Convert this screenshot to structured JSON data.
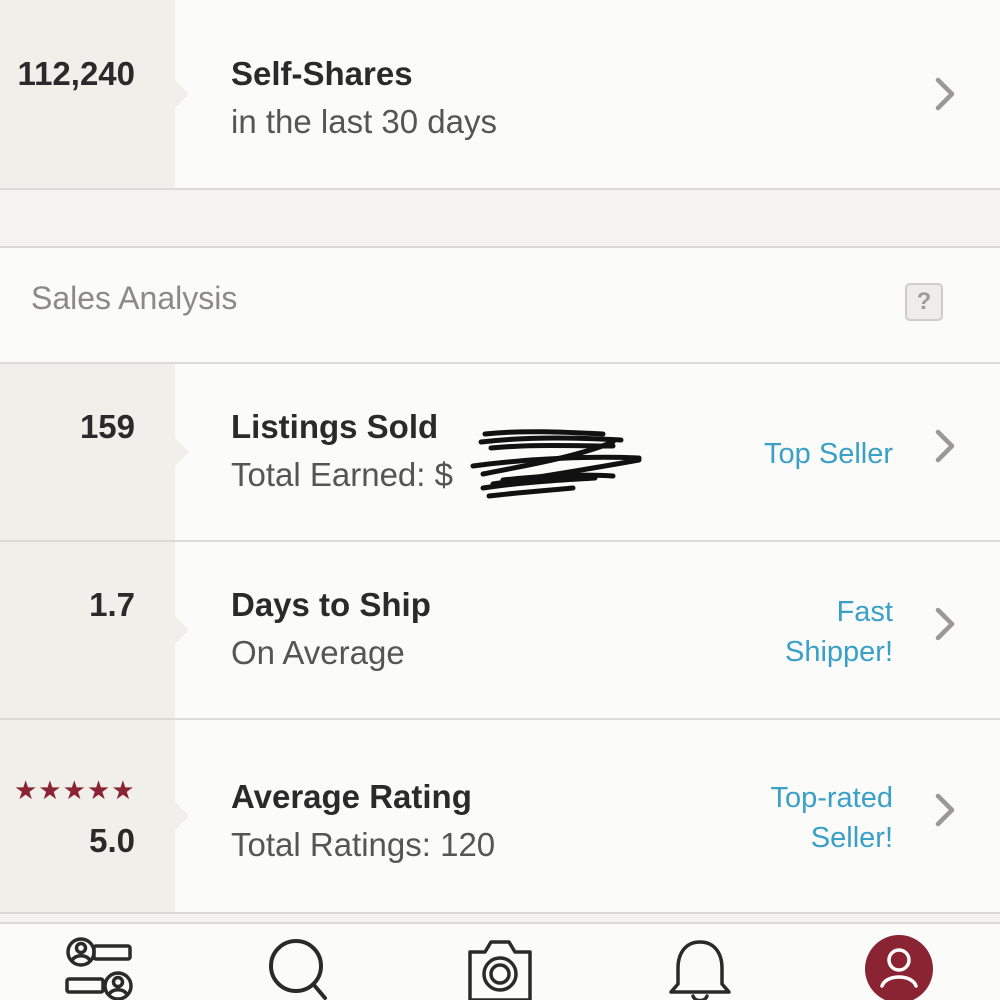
{
  "self_shares": {
    "count": "112,240",
    "title": "Self-Shares",
    "subtitle": "in the last 30 days"
  },
  "sales_analysis": {
    "title": "Sales Analysis",
    "help_label": "?",
    "rows": [
      {
        "stat": "159",
        "title": "Listings Sold",
        "subtitle": "Total Earned: $",
        "badge": "Top Seller"
      },
      {
        "stat": "1.7",
        "title": "Days to Ship",
        "subtitle": "On Average",
        "badge": "Fast Shipper!"
      },
      {
        "stat": "5.0",
        "stars": "★★★★★",
        "title": "Average Rating",
        "subtitle": "Total Ratings: 120",
        "badge": "Top-rated Seller!"
      }
    ]
  },
  "tabbar": {
    "icons": [
      "my-closet-icon",
      "search-icon",
      "camera-icon",
      "notifications-bell-icon",
      "profile-icon"
    ],
    "active": "profile-icon"
  },
  "colors": {
    "accent_link": "#3aa0c8",
    "brand": "#8a2433",
    "stat_panel": "#f1efe9"
  }
}
